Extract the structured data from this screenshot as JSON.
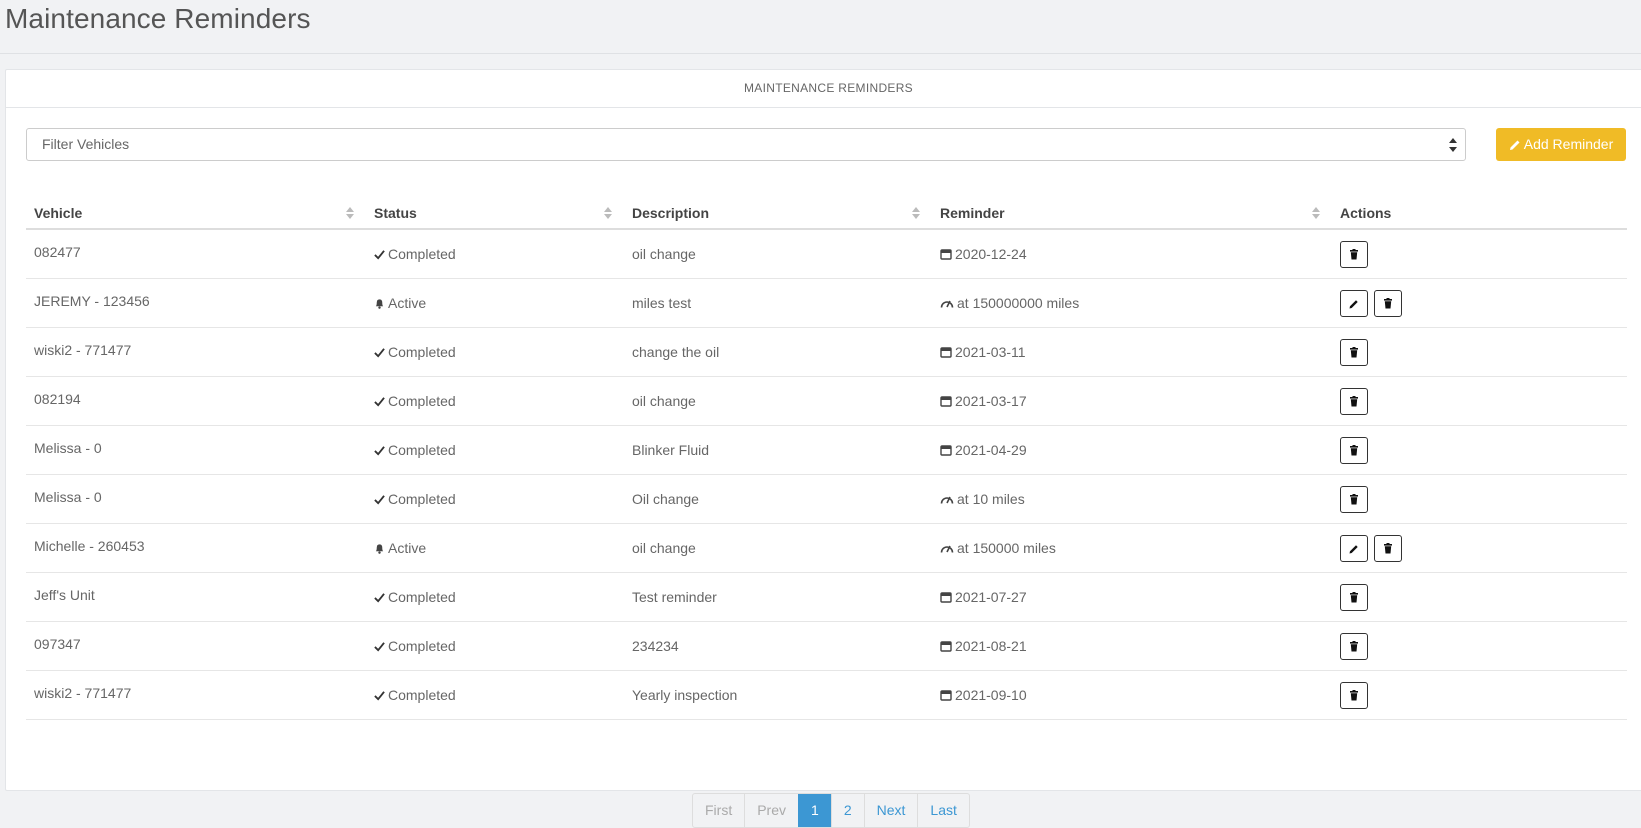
{
  "page": {
    "title": "Maintenance Reminders"
  },
  "panel": {
    "header": "MAINTENANCE REMINDERS"
  },
  "filter": {
    "placeholder": "Filter Vehicles"
  },
  "add_button": {
    "label": "Add Reminder",
    "icon": "pencil-icon",
    "color": "#f0bb26"
  },
  "table": {
    "headers": [
      "Vehicle",
      "Status",
      "Description",
      "Reminder",
      "Actions"
    ],
    "rows": [
      {
        "vehicle": "082477",
        "status": "Completed",
        "status_icon": "check-icon",
        "description": "oil change",
        "reminder": "2020-12-24",
        "reminder_icon": "calendar-icon",
        "actions": [
          "delete"
        ]
      },
      {
        "vehicle": "JEREMY - 123456",
        "status": "Active",
        "status_icon": "bell-icon",
        "description": "miles test",
        "reminder": "at 150000000 miles",
        "reminder_icon": "gauge-icon",
        "actions": [
          "edit",
          "delete"
        ]
      },
      {
        "vehicle": "wiski2 - 771477",
        "status": "Completed",
        "status_icon": "check-icon",
        "description": "change the oil",
        "reminder": "2021-03-11",
        "reminder_icon": "calendar-icon",
        "actions": [
          "delete"
        ]
      },
      {
        "vehicle": "082194",
        "status": "Completed",
        "status_icon": "check-icon",
        "description": "oil change",
        "reminder": "2021-03-17",
        "reminder_icon": "calendar-icon",
        "actions": [
          "delete"
        ]
      },
      {
        "vehicle": "Melissa - 0",
        "status": "Completed",
        "status_icon": "check-icon",
        "description": "Blinker Fluid",
        "reminder": "2021-04-29",
        "reminder_icon": "calendar-icon",
        "actions": [
          "delete"
        ]
      },
      {
        "vehicle": "Melissa - 0",
        "status": "Completed",
        "status_icon": "check-icon",
        "description": "Oil change",
        "reminder": "at 10 miles",
        "reminder_icon": "gauge-icon",
        "actions": [
          "delete"
        ]
      },
      {
        "vehicle": "Michelle - 260453",
        "status": "Active",
        "status_icon": "bell-icon",
        "description": "oil change",
        "reminder": "at 150000 miles",
        "reminder_icon": "gauge-icon",
        "actions": [
          "edit",
          "delete"
        ]
      },
      {
        "vehicle": "Jeff's Unit",
        "status": "Completed",
        "status_icon": "check-icon",
        "description": "Test reminder",
        "reminder": "2021-07-27",
        "reminder_icon": "calendar-icon",
        "actions": [
          "delete"
        ]
      },
      {
        "vehicle": "097347",
        "status": "Completed",
        "status_icon": "check-icon",
        "description": "234234",
        "reminder": "2021-08-21",
        "reminder_icon": "calendar-icon",
        "actions": [
          "delete"
        ]
      },
      {
        "vehicle": "wiski2 - 771477",
        "status": "Completed",
        "status_icon": "check-icon",
        "description": "Yearly inspection",
        "reminder": "2021-09-10",
        "reminder_icon": "calendar-icon",
        "actions": [
          "delete"
        ]
      }
    ]
  },
  "pagination": {
    "items": [
      {
        "label": "First",
        "state": "disabled"
      },
      {
        "label": "Prev",
        "state": "disabled"
      },
      {
        "label": "1",
        "state": "active"
      },
      {
        "label": "2",
        "state": "normal"
      },
      {
        "label": "Next",
        "state": "normal"
      },
      {
        "label": "Last",
        "state": "normal"
      }
    ],
    "accent": "#3c97d3"
  }
}
